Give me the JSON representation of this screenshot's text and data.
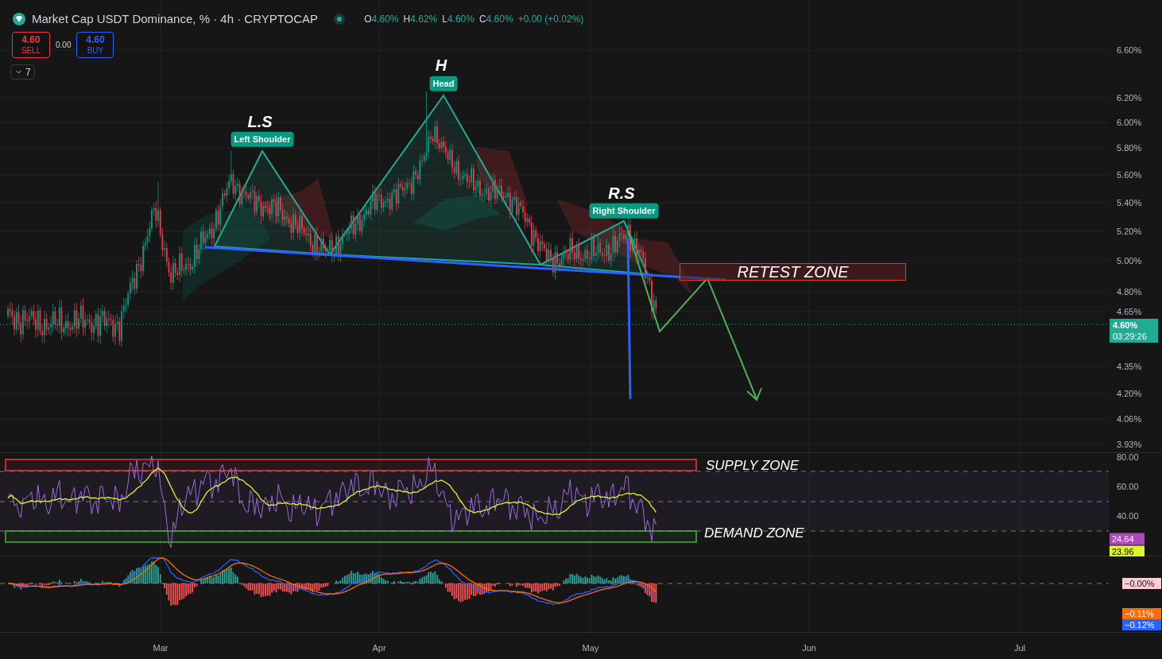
{
  "header": {
    "title": "Market Cap USDT Dominance, % · 4h · CRYPTOCAP",
    "ohlc": [
      {
        "label": "O",
        "value": "4.60%"
      },
      {
        "label": "H",
        "value": "4.62%"
      },
      {
        "label": "L",
        "value": "4.60%"
      },
      {
        "label": "C",
        "value": "4.60%"
      }
    ],
    "change": "+0.00 (+0.02%)"
  },
  "trade": {
    "sell": {
      "price": "4.60",
      "label": "SELL"
    },
    "spread": "0.00",
    "buy": {
      "price": "4.60",
      "label": "BUY"
    }
  },
  "indicators_toggle": {
    "count": "7"
  },
  "annotations": [
    {
      "title": "L.S",
      "label": "Left Shoulder"
    },
    {
      "title": "H",
      "label": "Head"
    },
    {
      "title": "R.S",
      "label": "Right Shoulder"
    }
  ],
  "retest_zone": {
    "label": "RETEST ZONE"
  },
  "price_axis": {
    "ticks": [
      "6.60%",
      "6.20%",
      "6.00%",
      "5.80%",
      "5.60%",
      "5.40%",
      "5.20%",
      "5.00%",
      "4.80%",
      "4.65%",
      "4.35%",
      "4.20%",
      "4.06%",
      "3.93%"
    ],
    "last_price": "4.60%",
    "countdown": "03:29:26"
  },
  "rsi": {
    "zones": [
      {
        "kind": "supply",
        "label": "SUPPLY ZONE"
      },
      {
        "kind": "demand",
        "label": "DEMAND ZONE"
      }
    ],
    "axis": [
      "80.00",
      "60.00",
      "40.00"
    ],
    "badges": [
      {
        "kind": "rsi",
        "value": "24.64"
      },
      {
        "kind": "ma",
        "value": "23.96"
      }
    ]
  },
  "macd": {
    "badges": [
      {
        "kind": "histogram",
        "value": "−0.00%"
      },
      {
        "kind": "signal",
        "value": "−0.11%"
      },
      {
        "kind": "macd",
        "value": "−0.12%"
      }
    ]
  },
  "time_axis": [
    "Mar",
    "Apr",
    "May",
    "Jun",
    "Jul"
  ]
}
